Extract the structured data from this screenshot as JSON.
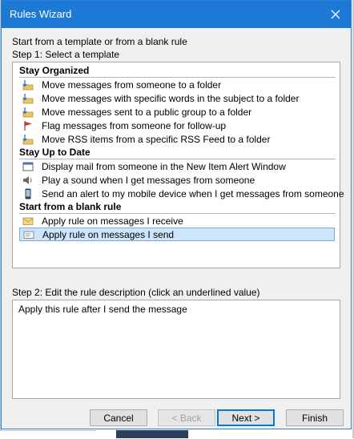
{
  "window": {
    "title": "Rules Wizard"
  },
  "intro": "Start from a template or from a blank rule",
  "step1_label": "Step 1: Select a template",
  "sections": {
    "organized": {
      "title": "Stay Organized",
      "items": [
        "Move messages from someone to a folder",
        "Move messages with specific words in the subject to a folder",
        "Move messages sent to a public group to a folder",
        "Flag messages from someone for follow-up",
        "Move RSS items from a specific RSS Feed to a folder"
      ]
    },
    "uptodate": {
      "title": "Stay Up to Date",
      "items": [
        "Display mail from someone in the New Item Alert Window",
        "Play a sound when I get messages from someone",
        "Send an alert to my mobile device when I get messages from someone"
      ]
    },
    "blank": {
      "title": "Start from a blank rule",
      "items": [
        "Apply rule on messages I receive",
        "Apply rule on messages I send"
      ]
    }
  },
  "selected_item": "Apply rule on messages I send",
  "step2_label": "Step 2: Edit the rule description (click an underlined value)",
  "description": "Apply this rule after I send the message",
  "buttons": {
    "cancel": "Cancel",
    "back": "< Back",
    "next": "Next >",
    "finish": "Finish"
  },
  "colors": {
    "title_bar": "#1c7ad6",
    "selection": "#cde5fb",
    "dialog_bg": "#f0f0f0"
  },
  "icons": {
    "move": "folder-move-icon",
    "flag": "red-flag-icon",
    "alert": "alert-window-icon",
    "sound": "speaker-icon",
    "mobile": "mobile-device-icon",
    "envelope": "envelope-icon",
    "envelope_send": "envelope-send-icon"
  }
}
